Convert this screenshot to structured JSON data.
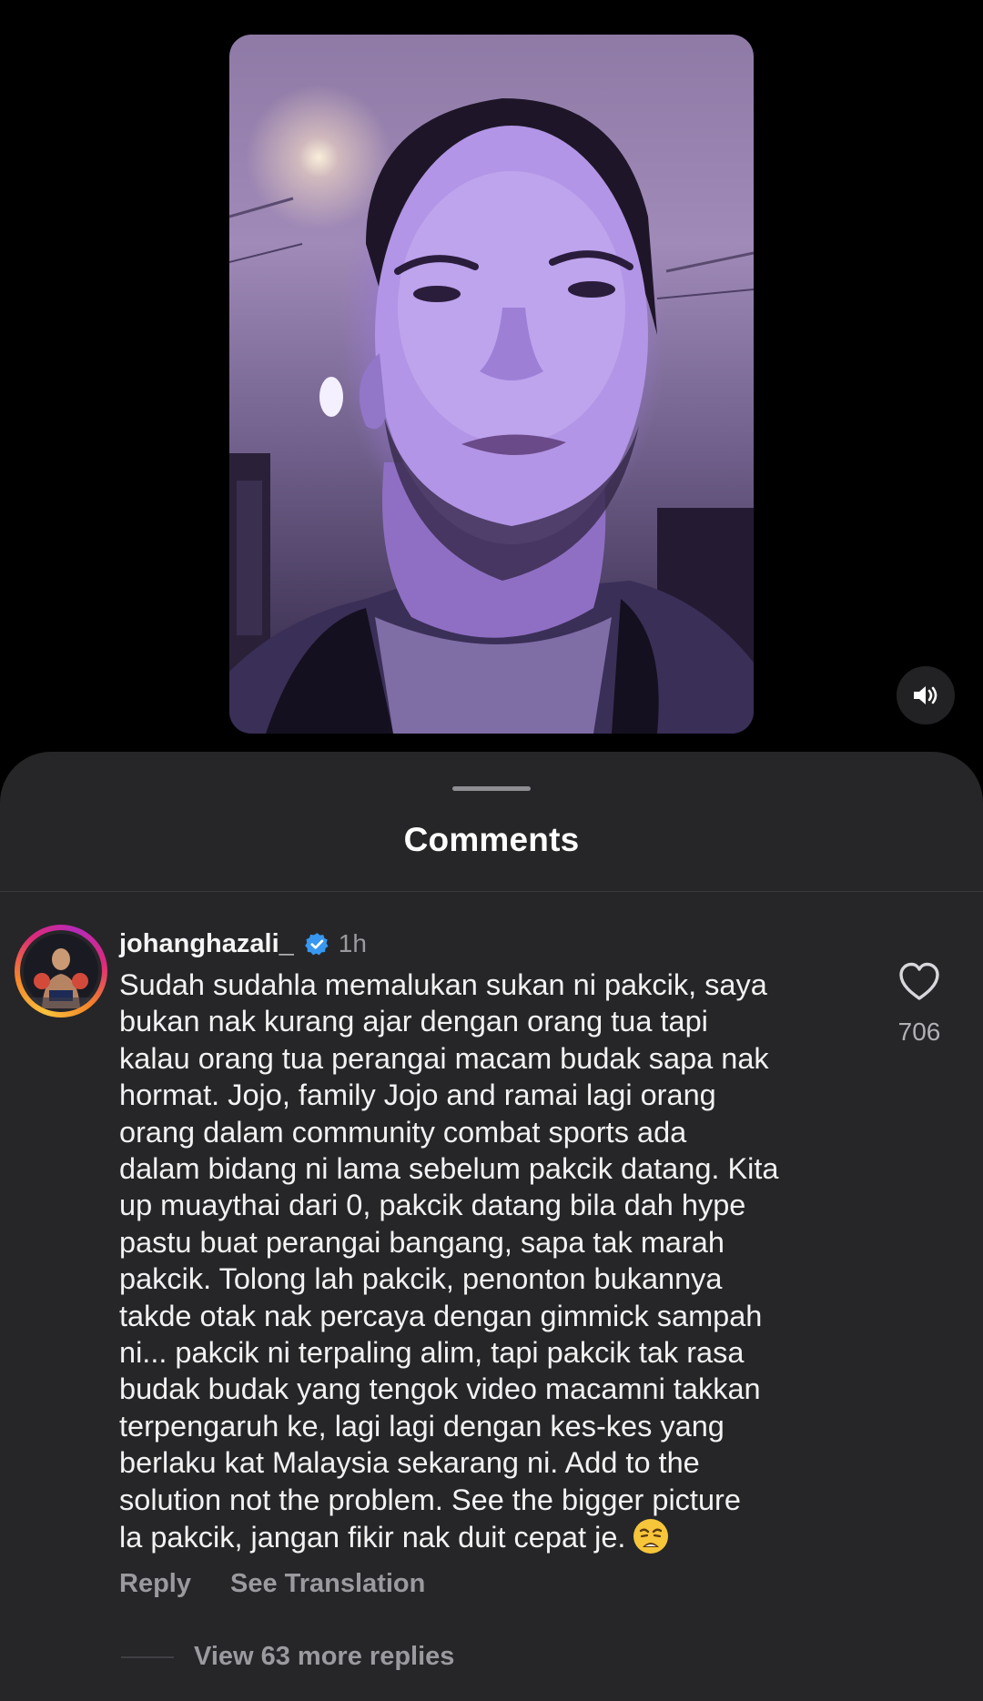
{
  "video": {
    "image": "selfie-video-frame"
  },
  "mute_button": {
    "icon": "speaker-muted-icon"
  },
  "comments_sheet": {
    "title": "Comments"
  },
  "comment": {
    "username": "johanghazali_",
    "verified": true,
    "time": "1h",
    "text": "Sudah sudahla memalukan sukan ni pakcik, saya\nbukan nak kurang ajar dengan orang tua tapi\nkalau orang tua perangai macam budak sapa nak\nhormat. Jojo, family Jojo and ramai lagi orang\norang dalam community combat sports ada\ndalam bidang ni lama sebelum pakcik datang. Kita\nup muaythai dari 0, pakcik datang bila dah hype\npastu buat perangai bangang, sapa tak marah\npakcik. Tolong lah pakcik, penonton bukannya\ntakde otak nak percaya dengan gimmick sampah\nni... pakcik ni terpaling alim, tapi pakcik tak rasa\nbudak budak yang tengok video macamni takkan\nterpengaruh ke, lagi lagi dengan kes-kes yang\nberlaku kat Malaysia sekarang ni. Add to the\nsolution not the problem. See the bigger picture\nla pakcik, jangan fikir nak duit cepat je.",
    "emoji": "weary-face-emoji",
    "like_count": "706",
    "reply_label": "Reply",
    "translate_label": "See Translation",
    "view_replies_label": "View 63 more replies"
  },
  "colors": {
    "background": "#000000",
    "sheet": "#262629",
    "secondary_text": "#9a9a9f",
    "verified_badge": "#3897f0"
  }
}
